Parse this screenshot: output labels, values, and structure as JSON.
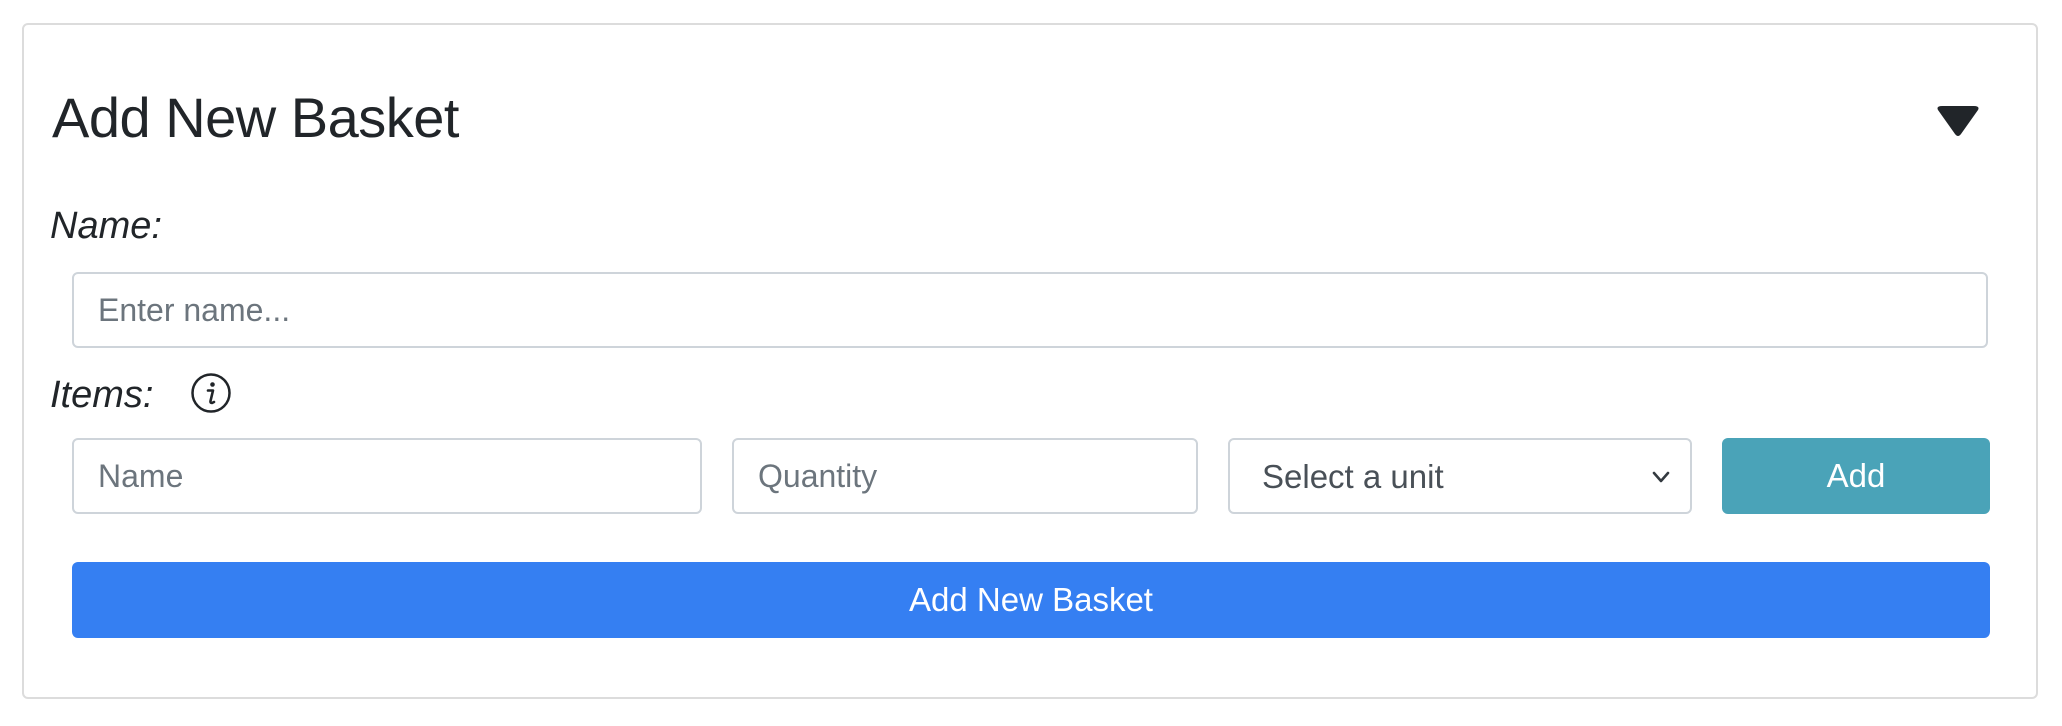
{
  "card": {
    "title": "Add New Basket",
    "toggle_icon": "caret-down-icon"
  },
  "form": {
    "name_label": "Name:",
    "name_placeholder": "Enter name...",
    "name_value": "",
    "items_label": "Items:",
    "items_info_icon": "info-circle-icon",
    "item_name_placeholder": "Name",
    "item_name_value": "",
    "quantity_placeholder": "Quantity",
    "quantity_value": "",
    "unit_selected": "Select a unit",
    "add_label": "Add",
    "submit_label": "Add New Basket"
  },
  "colors": {
    "add_button": "#4aa3b8",
    "submit_button": "#357ff2",
    "border": "#ced4da"
  }
}
